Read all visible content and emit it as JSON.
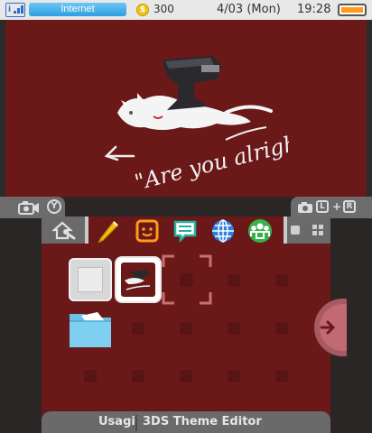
{
  "status_bar": {
    "connection_label": "Internet",
    "coin_symbol": "$",
    "coin_count": "300",
    "date": "4/03 (Mon)",
    "time": "19:28",
    "signal_letter": "i"
  },
  "banner": {
    "caption": "\"Are you alright?\""
  },
  "shoulder_buttons": {
    "left_button": "Y",
    "l_button": "L",
    "plus": "+",
    "r_button": "R"
  },
  "app_bar": {
    "icons": [
      "settings-icon",
      "notes-icon",
      "miiverse-smile-icon",
      "chat-icon",
      "browser-icon",
      "friends-icon"
    ]
  },
  "bottom_bar": {
    "user": "Usagi",
    "title": "3DS Theme Editor"
  },
  "colors": {
    "wallpaper": "#6b1818",
    "slot": "#5a1414",
    "cursor": "#c87070",
    "internet_pill": "#2e9fe0",
    "battery": "#ff9a1a"
  }
}
